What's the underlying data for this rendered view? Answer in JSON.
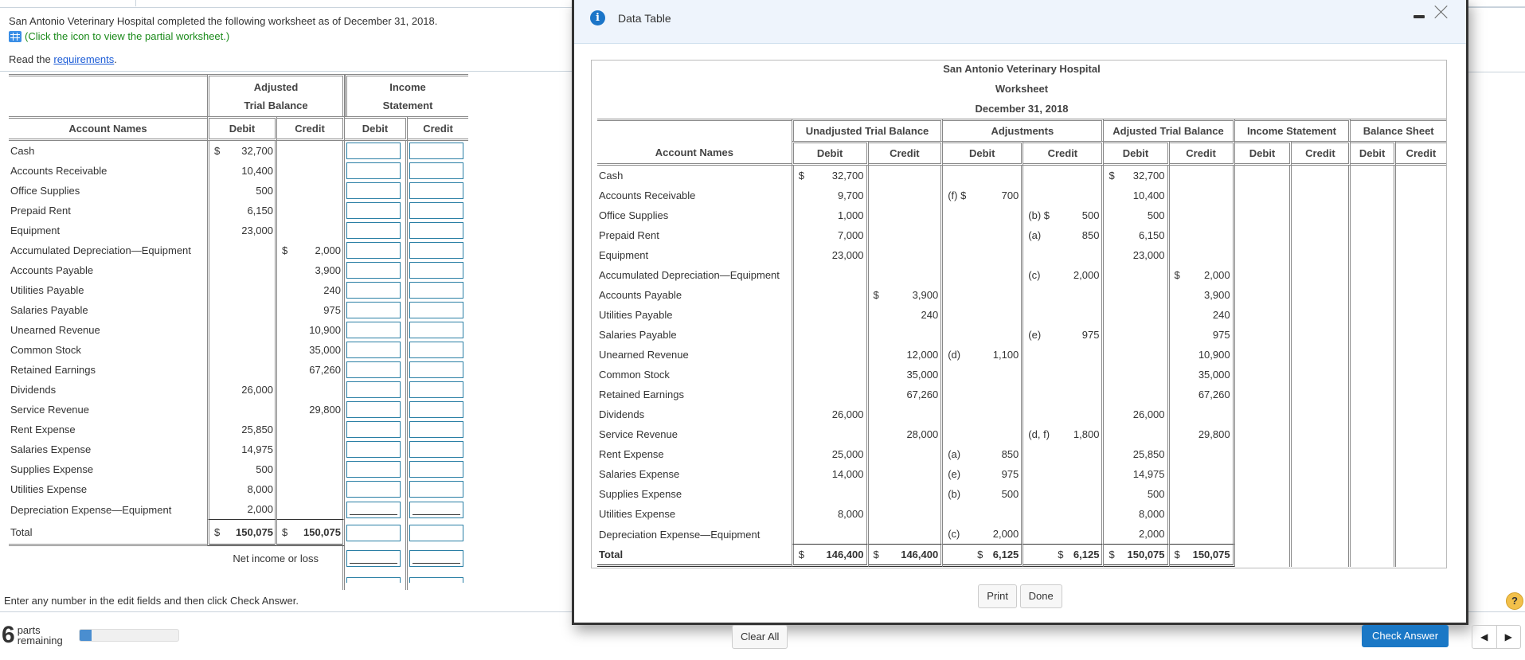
{
  "intro": {
    "text": "San Antonio Veterinary Hospital completed the following worksheet as of December 31, 2018.",
    "icon_link": "(Click the icon to view the partial worksheet.)",
    "read_prefix": "Read the ",
    "read_link": "requirements",
    "read_suffix": "."
  },
  "worksheet": {
    "group_headers": [
      {
        "line1": "Adjusted",
        "line2": "Trial Balance"
      },
      {
        "line1": "Income",
        "line2": "Statement"
      }
    ],
    "col_headers": [
      "Account Names",
      "Debit",
      "Credit",
      "Debit",
      "Credit"
    ],
    "rows": [
      {
        "name": "Cash",
        "debit": "32,700",
        "debit_dollar": "$",
        "credit": "",
        "credit_dollar": ""
      },
      {
        "name": "Accounts Receivable",
        "debit": "10,400",
        "credit": ""
      },
      {
        "name": "Office Supplies",
        "debit": "500",
        "credit": ""
      },
      {
        "name": "Prepaid Rent",
        "debit": "6,150",
        "credit": ""
      },
      {
        "name": "Equipment",
        "debit": "23,000",
        "credit": ""
      },
      {
        "name": "Accumulated Depreciation—Equipment",
        "debit": "",
        "credit": "2,000",
        "credit_dollar": "$"
      },
      {
        "name": "Accounts Payable",
        "debit": "",
        "credit": "3,900"
      },
      {
        "name": "Utilities Payable",
        "debit": "",
        "credit": "240"
      },
      {
        "name": "Salaries Payable",
        "debit": "",
        "credit": "975"
      },
      {
        "name": "Unearned Revenue",
        "debit": "",
        "credit": "10,900"
      },
      {
        "name": "Common Stock",
        "debit": "",
        "credit": "35,000"
      },
      {
        "name": "Retained Earnings",
        "debit": "",
        "credit": "67,260"
      },
      {
        "name": "Dividends",
        "debit": "26,000",
        "credit": ""
      },
      {
        "name": "Service Revenue",
        "debit": "",
        "credit": "29,800"
      },
      {
        "name": "Rent Expense",
        "debit": "25,850",
        "credit": ""
      },
      {
        "name": "Salaries Expense",
        "debit": "14,975",
        "credit": ""
      },
      {
        "name": "Supplies Expense",
        "debit": "500",
        "credit": ""
      },
      {
        "name": "Utilities Expense",
        "debit": "8,000",
        "credit": ""
      },
      {
        "name": "Depreciation Expense—Equipment",
        "debit": "2,000",
        "credit": ""
      }
    ],
    "total": {
      "name": "Total",
      "dollar": "$",
      "debit": "150,075",
      "credit": "150,075"
    },
    "net_income_label": "Net income or loss",
    "income_inputs": {
      "debit_value": "",
      "credit_value": ""
    }
  },
  "instructions": "Enter any number in the edit fields and then click Check Answer.",
  "parts": {
    "count": "6",
    "label1": "parts",
    "label2": "remaining",
    "progress_fraction": 0.12
  },
  "modal": {
    "title": "Data Table",
    "company": "San Antonio Veterinary Hospital",
    "report": "Worksheet",
    "date": "December 31, 2018",
    "groups": [
      "Unadjusted Trial Balance",
      "Adjustments",
      "Adjusted Trial Balance",
      "Income Statement",
      "Balance Sheet"
    ],
    "account_col": "Account Names",
    "debit": "Debit",
    "credit": "Credit",
    "rows": [
      {
        "name": "Cash",
        "utb_d": "32,700",
        "utb_d_s": "$",
        "utb_c": "",
        "adj_d_ref": "",
        "adj_d": "",
        "adj_c_ref": "",
        "adj_c": "",
        "atb_d": "32,700",
        "atb_d_s": "$",
        "atb_c": ""
      },
      {
        "name": "Accounts Receivable",
        "utb_d": "9,700",
        "utb_c": "",
        "adj_d_ref": "(f) $",
        "adj_d": "700",
        "adj_c_ref": "",
        "adj_c": "",
        "atb_d": "10,400",
        "atb_c": ""
      },
      {
        "name": "Office Supplies",
        "utb_d": "1,000",
        "utb_c": "",
        "adj_d_ref": "",
        "adj_d": "",
        "adj_c_ref": "(b) $",
        "adj_c": "500",
        "atb_d": "500",
        "atb_c": ""
      },
      {
        "name": "Prepaid Rent",
        "utb_d": "7,000",
        "utb_c": "",
        "adj_d_ref": "",
        "adj_d": "",
        "adj_c_ref": "(a)",
        "adj_c": "850",
        "atb_d": "6,150",
        "atb_c": ""
      },
      {
        "name": "Equipment",
        "utb_d": "23,000",
        "utb_c": "",
        "adj_d_ref": "",
        "adj_d": "",
        "adj_c_ref": "",
        "adj_c": "",
        "atb_d": "23,000",
        "atb_c": ""
      },
      {
        "name": "Accumulated Depreciation—Equipment",
        "utb_d": "",
        "utb_c": "",
        "adj_d_ref": "",
        "adj_d": "",
        "adj_c_ref": "(c)",
        "adj_c": "2,000",
        "atb_d": "",
        "atb_c": "2,000",
        "atb_c_s": "$"
      },
      {
        "name": "Accounts Payable",
        "utb_d": "",
        "utb_c": "3,900",
        "utb_c_s": "$",
        "adj_d_ref": "",
        "adj_d": "",
        "adj_c_ref": "",
        "adj_c": "",
        "atb_d": "",
        "atb_c": "3,900"
      },
      {
        "name": "Utilities Payable",
        "utb_d": "",
        "utb_c": "240",
        "adj_d_ref": "",
        "adj_d": "",
        "adj_c_ref": "",
        "adj_c": "",
        "atb_d": "",
        "atb_c": "240"
      },
      {
        "name": "Salaries Payable",
        "utb_d": "",
        "utb_c": "",
        "adj_d_ref": "",
        "adj_d": "",
        "adj_c_ref": "(e)",
        "adj_c": "975",
        "atb_d": "",
        "atb_c": "975"
      },
      {
        "name": "Unearned Revenue",
        "utb_d": "",
        "utb_c": "12,000",
        "adj_d_ref": "(d)",
        "adj_d": "1,100",
        "adj_c_ref": "",
        "adj_c": "",
        "atb_d": "",
        "atb_c": "10,900"
      },
      {
        "name": "Common Stock",
        "utb_d": "",
        "utb_c": "35,000",
        "adj_d_ref": "",
        "adj_d": "",
        "adj_c_ref": "",
        "adj_c": "",
        "atb_d": "",
        "atb_c": "35,000"
      },
      {
        "name": "Retained Earnings",
        "utb_d": "",
        "utb_c": "67,260",
        "adj_d_ref": "",
        "adj_d": "",
        "adj_c_ref": "",
        "adj_c": "",
        "atb_d": "",
        "atb_c": "67,260"
      },
      {
        "name": "Dividends",
        "utb_d": "26,000",
        "utb_c": "",
        "adj_d_ref": "",
        "adj_d": "",
        "adj_c_ref": "",
        "adj_c": "",
        "atb_d": "26,000",
        "atb_c": ""
      },
      {
        "name": "Service Revenue",
        "utb_d": "",
        "utb_c": "28,000",
        "adj_d_ref": "",
        "adj_d": "",
        "adj_c_ref": "(d, f)",
        "adj_c": "1,800",
        "atb_d": "",
        "atb_c": "29,800"
      },
      {
        "name": "Rent Expense",
        "utb_d": "25,000",
        "utb_c": "",
        "adj_d_ref": "(a)",
        "adj_d": "850",
        "adj_c_ref": "",
        "adj_c": "",
        "atb_d": "25,850",
        "atb_c": ""
      },
      {
        "name": "Salaries Expense",
        "utb_d": "14,000",
        "utb_c": "",
        "adj_d_ref": "(e)",
        "adj_d": "975",
        "adj_c_ref": "",
        "adj_c": "",
        "atb_d": "14,975",
        "atb_c": ""
      },
      {
        "name": "Supplies Expense",
        "utb_d": "",
        "utb_c": "",
        "adj_d_ref": "(b)",
        "adj_d": "500",
        "adj_c_ref": "",
        "adj_c": "",
        "atb_d": "500",
        "atb_c": ""
      },
      {
        "name": "Utilities Expense",
        "utb_d": "8,000",
        "utb_c": "",
        "adj_d_ref": "",
        "adj_d": "",
        "adj_c_ref": "",
        "adj_c": "",
        "atb_d": "8,000",
        "atb_c": ""
      },
      {
        "name": "Depreciation Expense—Equipment",
        "utb_d": "",
        "utb_c": "",
        "adj_d_ref": "(c)",
        "adj_d": "2,000",
        "adj_c_ref": "",
        "adj_c": "",
        "atb_d": "2,000",
        "atb_c": ""
      }
    ],
    "total": {
      "name": "Total",
      "utb_d": "146,400",
      "utb_c": "146,400",
      "adj_d": "6,125",
      "adj_c": "6,125",
      "atb_d": "150,075",
      "atb_c": "150,075",
      "dollar": "$"
    },
    "print_label": "Print",
    "done_label": "Done"
  },
  "footer": {
    "clear_all": "Clear All",
    "check_answer": "Check Answer",
    "help": "?",
    "prev_icon": "◀",
    "next_icon": "▶"
  },
  "colors": {
    "accent": "#1a78c6",
    "input_border": "#2a7fa5",
    "link_green": "#1a8a1a",
    "info": "#1b75c8"
  }
}
